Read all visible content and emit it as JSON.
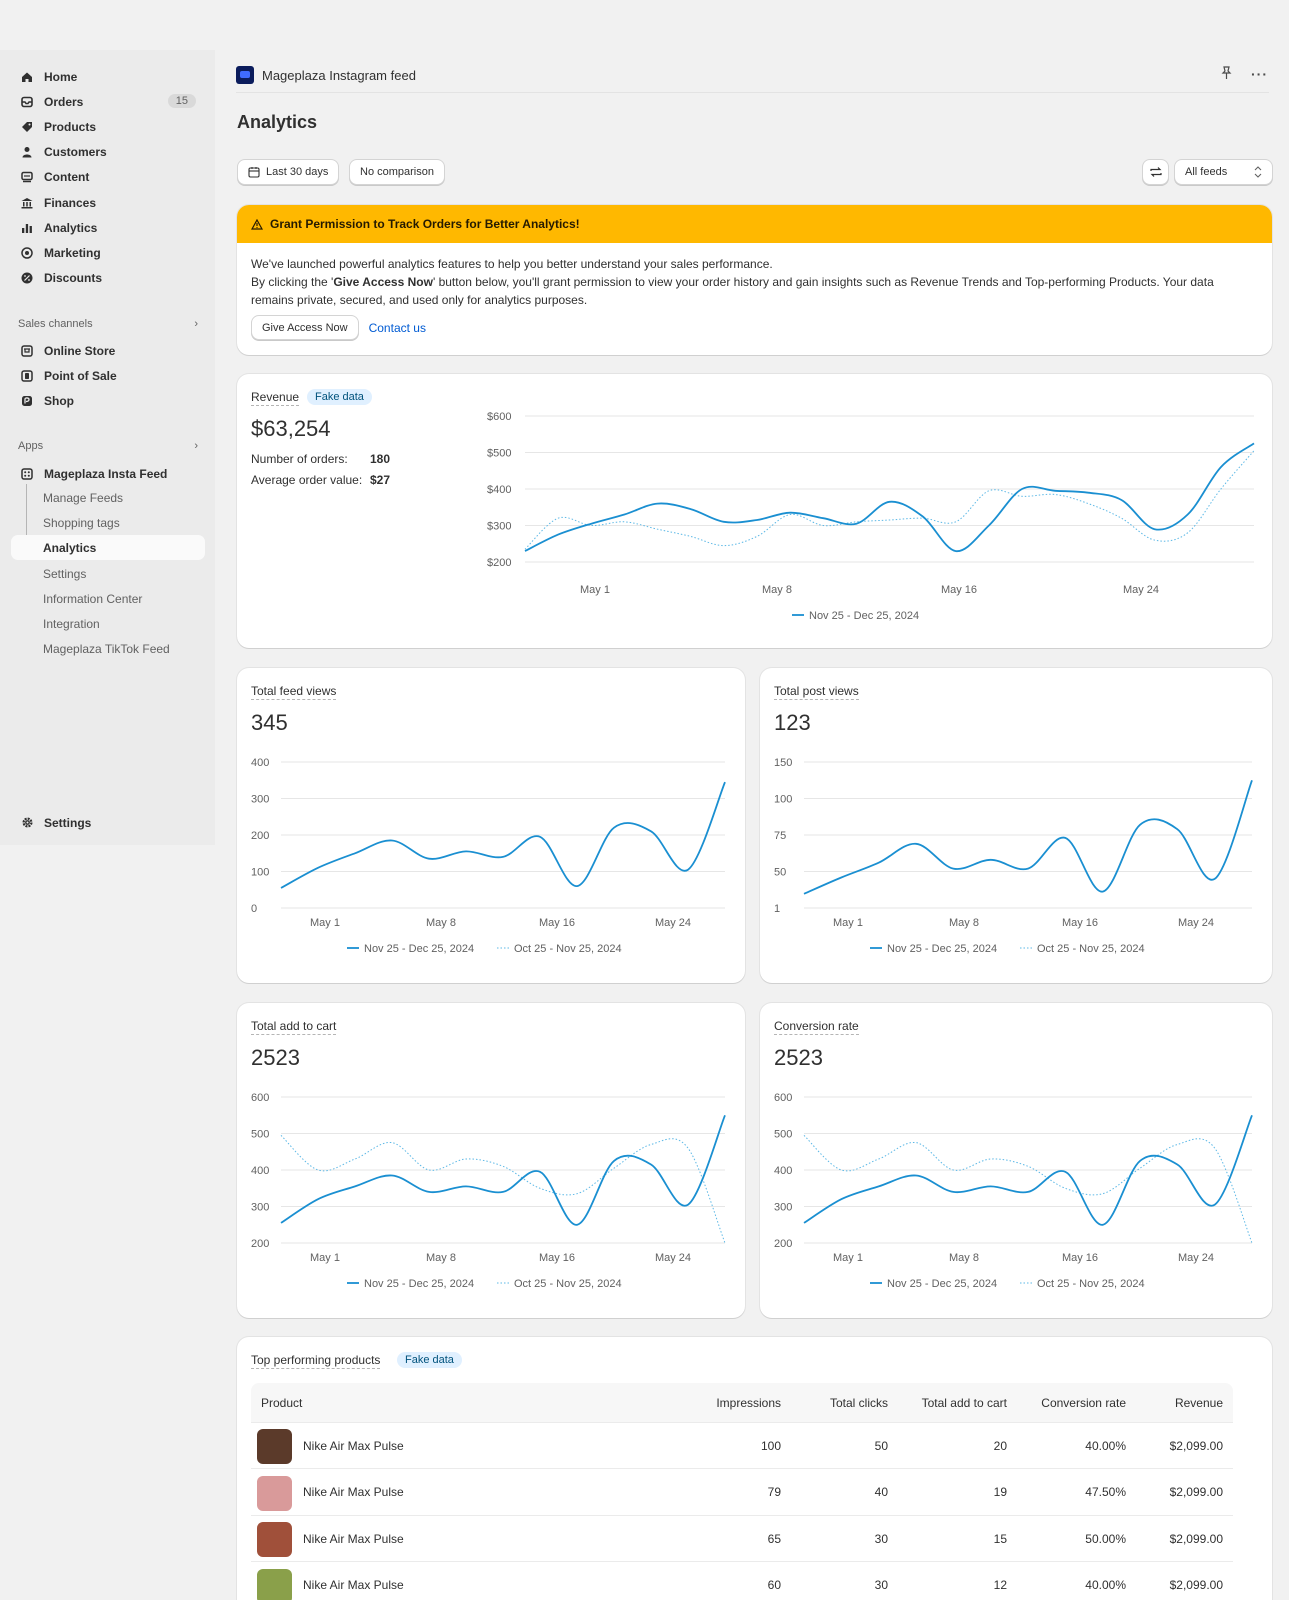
{
  "sidebar": {
    "items": [
      {
        "label": "Home",
        "icon": "home-icon"
      },
      {
        "label": "Orders",
        "icon": "orders-icon",
        "badge": "15"
      },
      {
        "label": "Products",
        "icon": "tag-icon"
      },
      {
        "label": "Customers",
        "icon": "person-icon"
      },
      {
        "label": "Content",
        "icon": "content-icon"
      },
      {
        "label": "Finances",
        "icon": "bank-icon"
      },
      {
        "label": "Analytics",
        "icon": "bar-chart-icon"
      },
      {
        "label": "Marketing",
        "icon": "target-icon"
      },
      {
        "label": "Discounts",
        "icon": "discount-icon"
      }
    ],
    "sales_channels_label": "Sales channels",
    "sales_channels": [
      {
        "label": "Online Store",
        "icon": "store-icon"
      },
      {
        "label": "Point of Sale",
        "icon": "pos-icon"
      },
      {
        "label": "Shop",
        "icon": "shop-icon"
      }
    ],
    "apps_label": "Apps",
    "app_name": "Mageplaza Insta Feed",
    "app_subitems": [
      "Manage Feeds",
      "Shopping tags",
      "Analytics",
      "Settings",
      "Information Center",
      "Integration",
      "Mageplaza TikTok Feed"
    ],
    "settings_label": "Settings"
  },
  "header": {
    "app_title": "Mageplaza Instagram feed",
    "page_title": "Analytics",
    "date_range": "Last 30 days",
    "comparison": "No comparison",
    "feed_select": "All feeds"
  },
  "banner": {
    "title": "Grant Permission to Track Orders for Better Analytics!",
    "line1": "We've launched powerful analytics features to help you better understand your sales performance.",
    "line2_pre": "By clicking the '",
    "line2_bold": "Give Access Now",
    "line2_post": "' button below, you'll grant permission to view your order history and gain insights such as Revenue Trends and Top-performing Products. Your data remains private, secured, and used only for analytics purposes.",
    "primary_btn": "Give Access Now",
    "contact_link": "Contact us"
  },
  "revenue": {
    "title": "Revenue",
    "badge": "Fake data",
    "value": "$63,254",
    "orders_label": "Number of orders:",
    "orders_value": "180",
    "aov_label": "Average order value:",
    "aov_value": "$27"
  },
  "fake_badge": "Fake data",
  "metrics": {
    "feed_views": {
      "title": "Total feed views",
      "value": "345"
    },
    "post_views": {
      "title": "Total post views",
      "value": "123"
    },
    "add_to_cart": {
      "title": "Total add to cart",
      "value": "2523"
    },
    "conversion": {
      "title": "Conversion rate",
      "value": "2523"
    }
  },
  "products": {
    "title": "Top performing products",
    "badge": "Fake data",
    "columns": [
      "Product",
      "Impressions",
      "Total clicks",
      "Total add to cart",
      "Conversion rate",
      "Revenue"
    ],
    "rows": [
      {
        "name": "Nike Air Max Pulse",
        "impressions": "100",
        "clicks": "50",
        "add_to_cart": "20",
        "conversion": "40.00%",
        "revenue": "$2,099.00",
        "thumb": "#5b3a2a"
      },
      {
        "name": "Nike Air Max Pulse",
        "impressions": "79",
        "clicks": "40",
        "add_to_cart": "19",
        "conversion": "47.50%",
        "revenue": "$2,099.00",
        "thumb": "#d99a9a"
      },
      {
        "name": "Nike Air Max Pulse",
        "impressions": "65",
        "clicks": "30",
        "add_to_cart": "15",
        "conversion": "50.00%",
        "revenue": "$2,099.00",
        "thumb": "#a0503a"
      },
      {
        "name": "Nike Air Max Pulse",
        "impressions": "60",
        "clicks": "30",
        "add_to_cart": "12",
        "conversion": "40.00%",
        "revenue": "$2,099.00",
        "thumb": "#8aa04a"
      }
    ]
  },
  "chart_data": [
    {
      "id": "revenue",
      "type": "line",
      "x_ticks": [
        "May 1",
        "May 8",
        "May 16",
        "May 24"
      ],
      "ylim": [
        200,
        600
      ],
      "y_ticks": [
        "$600",
        "$500",
        "$400",
        "$300",
        "$200"
      ],
      "y_tick_values": [
        600,
        500,
        400,
        300,
        200
      ],
      "series": [
        {
          "name": "Nov 25 - Dec 25, 2024",
          "style": "solid",
          "values": [
            230,
            275,
            305,
            330,
            360,
            345,
            310,
            315,
            335,
            320,
            305,
            365,
            325,
            230,
            300,
            400,
            395,
            390,
            370,
            290,
            330,
            460,
            525
          ]
        },
        {
          "name": "",
          "style": "dotted",
          "values": [
            235,
            320,
            300,
            310,
            290,
            270,
            245,
            270,
            330,
            300,
            310,
            315,
            320,
            310,
            395,
            380,
            385,
            360,
            320,
            260,
            280,
            400,
            505
          ]
        }
      ],
      "legend": [
        "Nov 25 - Dec 25, 2024"
      ]
    },
    {
      "id": "feed_views",
      "type": "line",
      "x_ticks": [
        "May 1",
        "May 8",
        "May 16",
        "May 24"
      ],
      "ylim": [
        0,
        400
      ],
      "y_ticks": [
        "400",
        "300",
        "200",
        "100",
        "0"
      ],
      "y_tick_values": [
        400,
        300,
        200,
        100,
        0
      ],
      "series": [
        {
          "name": "Nov 25 - Dec 25, 2024",
          "style": "solid",
          "values": [
            55,
            110,
            150,
            185,
            135,
            155,
            140,
            195,
            60,
            220,
            210,
            105,
            345
          ]
        }
      ],
      "legend": [
        "Nov 25 - Dec 25, 2024",
        "Oct 25 - Nov 25, 2024"
      ]
    },
    {
      "id": "post_views",
      "type": "line",
      "x_ticks": [
        "May 1",
        "May 8",
        "May 16",
        "May 24"
      ],
      "ylim": [
        0,
        150
      ],
      "y_ticks": [
        "150",
        "100",
        "75",
        "50",
        "1"
      ],
      "y_tick_values": [
        150,
        100,
        75,
        50,
        1
      ],
      "series": [
        {
          "name": "Nov 25 - Dec 25, 2024",
          "style": "solid",
          "values": [
            20,
            42,
            56,
            69,
            52,
            58,
            52,
            73,
            23,
            82,
            79,
            40,
            125
          ]
        }
      ],
      "legend": [
        "Nov 25 - Dec 25, 2024",
        "Oct 25 - Nov 25, 2024"
      ]
    },
    {
      "id": "add_to_cart",
      "type": "line",
      "x_ticks": [
        "May 1",
        "May 8",
        "May 16",
        "May 24"
      ],
      "ylim": [
        200,
        600
      ],
      "y_ticks": [
        "600",
        "500",
        "400",
        "300",
        "200"
      ],
      "y_tick_values": [
        600,
        500,
        400,
        300,
        200
      ],
      "series": [
        {
          "name": "Nov 25 - Dec 25, 2024",
          "style": "solid",
          "values": [
            255,
            320,
            355,
            385,
            340,
            355,
            340,
            395,
            250,
            425,
            415,
            305,
            550
          ]
        },
        {
          "name": "Oct 25 - Nov 25, 2024",
          "style": "dotted",
          "values": [
            495,
            400,
            430,
            475,
            400,
            430,
            410,
            350,
            335,
            405,
            470,
            460,
            200
          ]
        }
      ],
      "legend": [
        "Nov 25 - Dec 25, 2024",
        "Oct 25 - Nov 25, 2024"
      ]
    },
    {
      "id": "conversion",
      "type": "line",
      "x_ticks": [
        "May 1",
        "May 8",
        "May 16",
        "May 24"
      ],
      "ylim": [
        200,
        600
      ],
      "y_ticks": [
        "600",
        "500",
        "400",
        "300",
        "200"
      ],
      "y_tick_values": [
        600,
        500,
        400,
        300,
        200
      ],
      "series": [
        {
          "name": "Nov 25 - Dec 25, 2024",
          "style": "solid",
          "values": [
            255,
            320,
            355,
            385,
            340,
            355,
            340,
            395,
            250,
            425,
            415,
            305,
            550
          ]
        },
        {
          "name": "Oct 25 - Nov 25, 2024",
          "style": "dotted",
          "values": [
            495,
            400,
            430,
            475,
            400,
            430,
            410,
            350,
            335,
            405,
            470,
            460,
            200
          ]
        }
      ],
      "legend": [
        "Nov 25 - Dec 25, 2024",
        "Oct 25 - Nov 25, 2024"
      ]
    }
  ]
}
